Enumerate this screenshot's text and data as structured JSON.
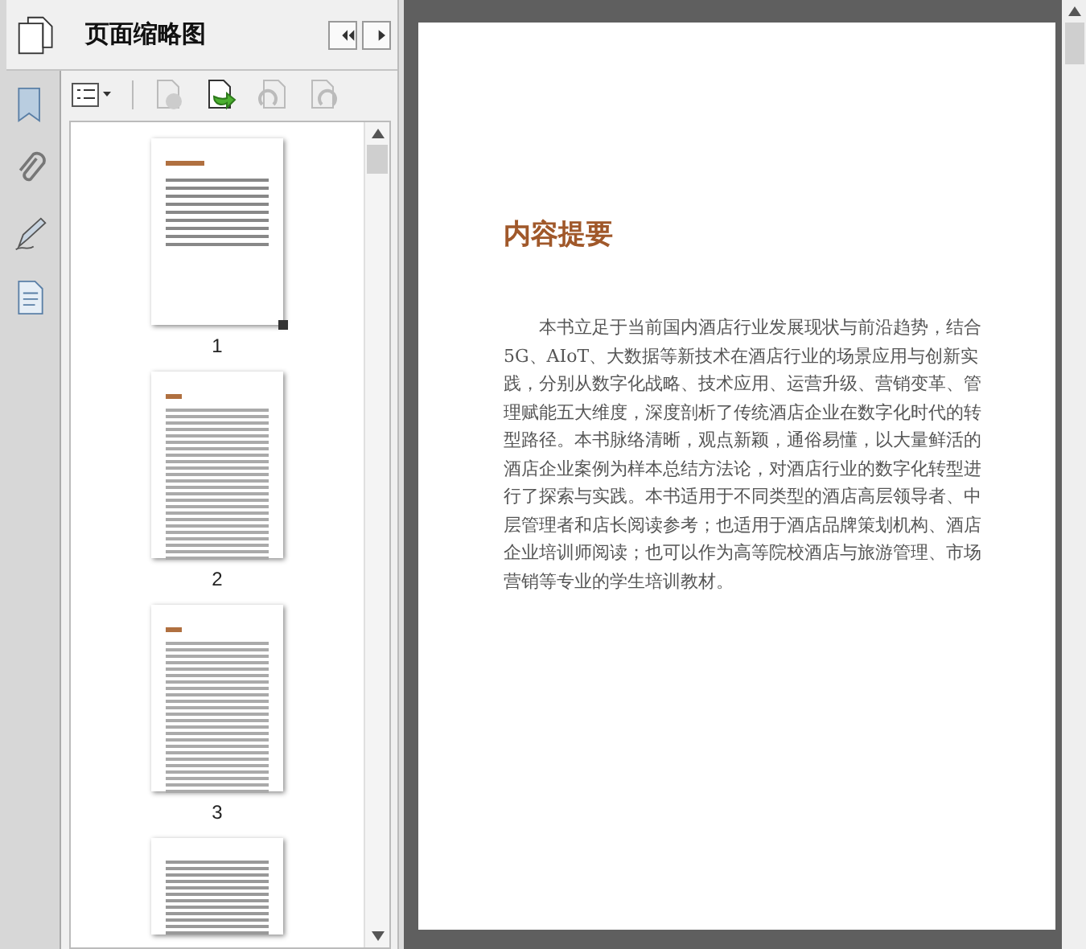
{
  "panel": {
    "title": "页面缩略图"
  },
  "thumbnails": [
    {
      "label": "1",
      "selected": true,
      "kind": "cover"
    },
    {
      "label": "2",
      "selected": false,
      "kind": "dense"
    },
    {
      "label": "3",
      "selected": false,
      "kind": "dense"
    },
    {
      "selected": false,
      "kind": "partial"
    }
  ],
  "page": {
    "heading": "内容提要",
    "paragraph": "本书立足于当前国内酒店行业发展现状与前沿趋势，结合5G、AIoT、大数据等新技术在酒店行业的场景应用与创新实践，分别从数字化战略、技术应用、运营升级、营销变革、管理赋能五大维度，深度剖析了传统酒店企业在数字化时代的转型路径。本书脉络清晰，观点新颖，通俗易懂，以大量鲜活的酒店企业案例为样本总结方法论，对酒店行业的数字化转型进行了探索与实践。本书适用于不同类型的酒店高层领导者、中层管理者和店长阅读参考；也适用于酒店品牌策划机构、酒店企业培训师阅读；也可以作为高等院校酒店与旅游管理、市场营销等专业的学生培训教材。"
  }
}
